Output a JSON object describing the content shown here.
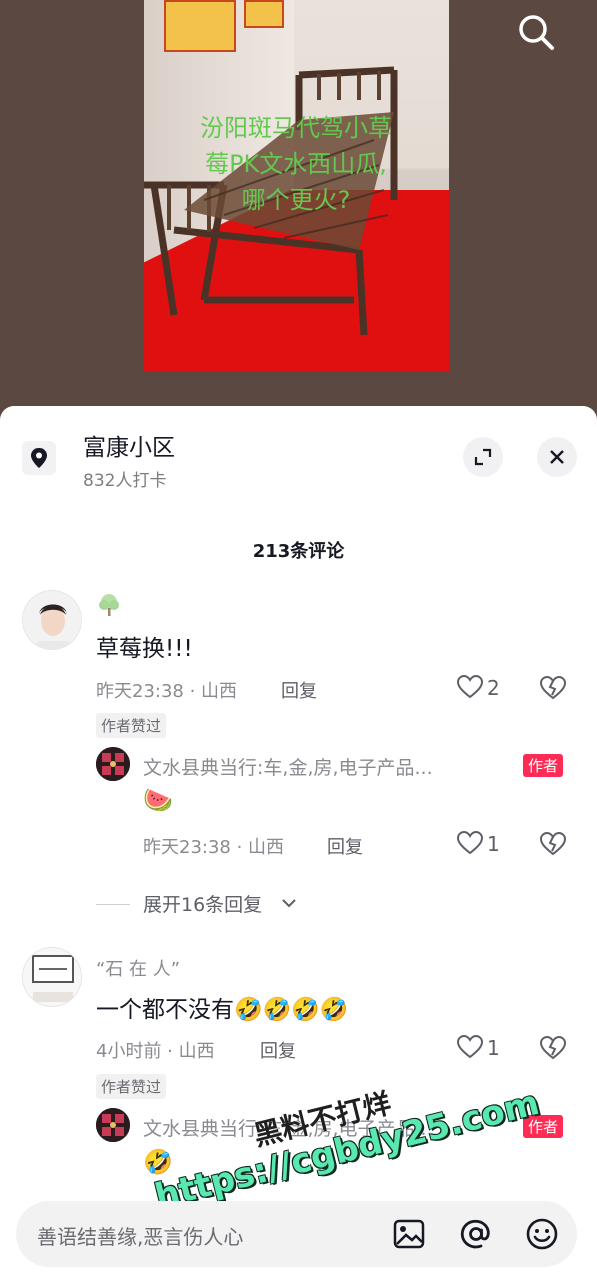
{
  "video": {
    "overlay_text": [
      "汾阳斑马代驾小草",
      "莓PK文水西山瓜,",
      "哪个更火?"
    ]
  },
  "location": {
    "name": "富康小区",
    "checkins": "832人打卡"
  },
  "comments": {
    "count_label": "213条评论",
    "items": [
      {
        "text": "草莓换!!!",
        "time_region": "昨天23:38 · 山西",
        "reply_label": "回复",
        "likes": "2",
        "badge": "作者赞过",
        "reply": {
          "name": "文水县典当行:车,金,房,电子产品...",
          "author_tag": "作者",
          "emoji": "🍉",
          "time_region": "昨天23:38 · 山西",
          "reply_label": "回复",
          "likes": "1"
        },
        "expand_label": "展开16条回复"
      },
      {
        "name": "“石 在 人”",
        "text": "一个都不没有🤣🤣🤣🤣",
        "time_region": "4小时前 · 山西",
        "reply_label": "回复",
        "likes": "1",
        "badge": "作者赞过",
        "reply": {
          "name": "文水县典当行:车,金,房,电子产品...",
          "author_tag": "作者",
          "emoji": "🤣"
        }
      }
    ]
  },
  "watermark": {
    "line1": "黑料不打烊",
    "line2": "https://cgbdy25.com"
  },
  "input": {
    "placeholder": "善语结善缘,恶言伤人心"
  },
  "icons": {
    "search": "search-icon",
    "location": "location-pin-icon",
    "expand": "expand-icon",
    "close": "close-icon",
    "like": "heart-icon",
    "dislike": "broken-heart-icon",
    "image": "image-icon",
    "mention": "at-icon",
    "emoji": "emoji-icon"
  },
  "colors": {
    "accent": "#fe2c55",
    "overlay_text": "#63c94e",
    "watermark": "#59e8b0"
  }
}
